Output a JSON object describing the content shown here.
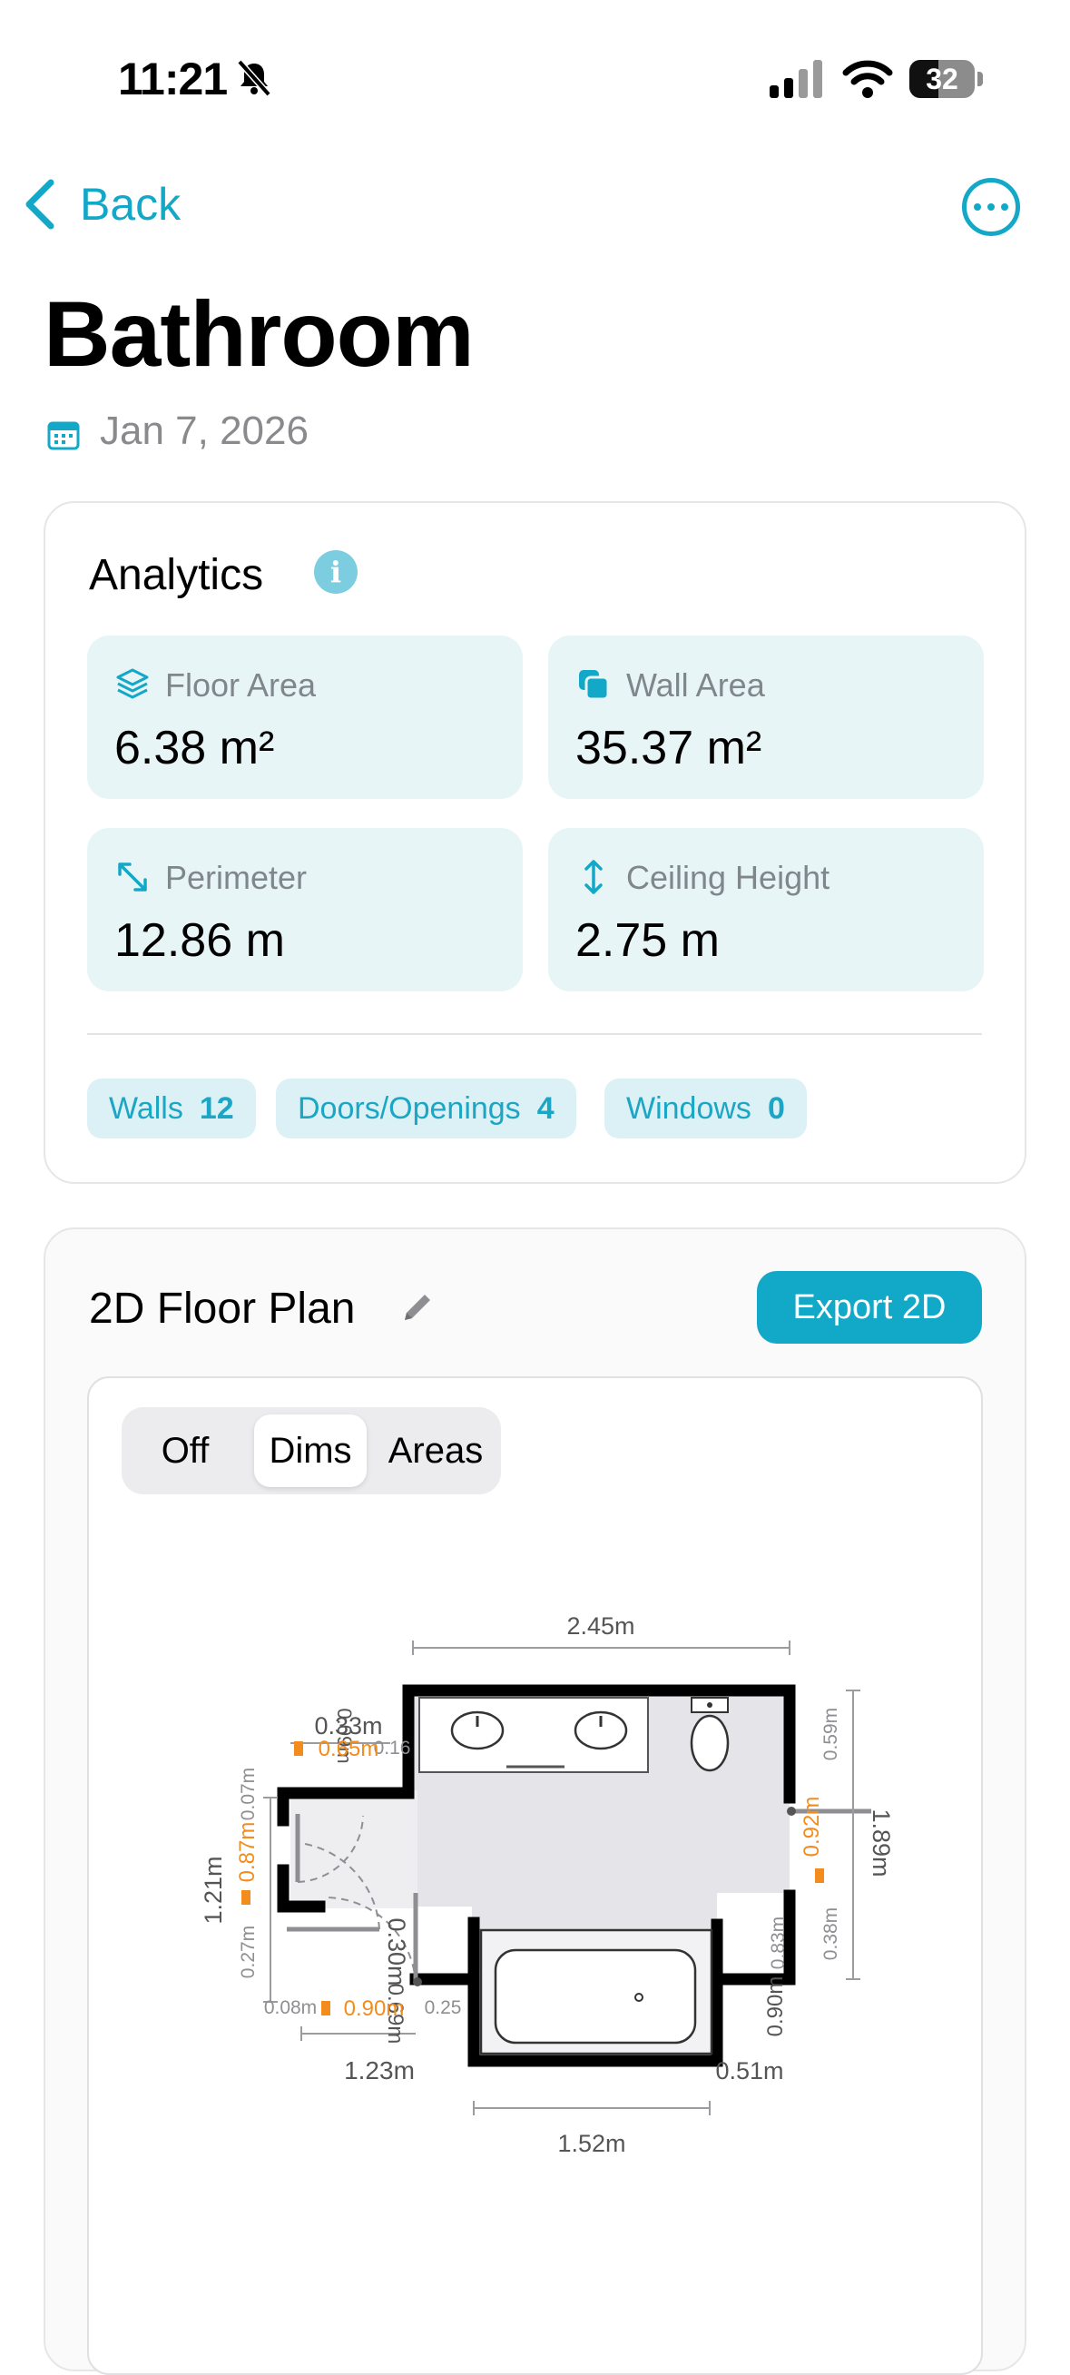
{
  "status_bar": {
    "time": "11:21",
    "battery": "32"
  },
  "nav": {
    "back_label": "Back"
  },
  "room": {
    "title": "Bathroom",
    "date": "Jan 7, 2026"
  },
  "analytics": {
    "title": "Analytics",
    "info_icon": "i",
    "stats": [
      {
        "label": "Floor Area",
        "value": "6.38 m²",
        "icon": "layers-icon"
      },
      {
        "label": "Wall Area",
        "value": "35.37 m²",
        "icon": "squares-icon"
      },
      {
        "label": "Perimeter",
        "value": "12.86 m",
        "icon": "expand-arrows-icon"
      },
      {
        "label": "Ceiling Height",
        "value": "2.75 m",
        "icon": "vertical-arrows-icon"
      }
    ],
    "counts": [
      {
        "label": "Walls",
        "value": "12"
      },
      {
        "label": "Doors/Openings",
        "value": "4"
      },
      {
        "label": "Windows",
        "value": "0"
      }
    ]
  },
  "floor_plan": {
    "title": "2D Floor Plan",
    "export_label": "Export 2D",
    "modes": [
      "Off",
      "Dims",
      "Areas"
    ],
    "selected_mode": "Dims",
    "dimensions": {
      "top": "2.45m",
      "top_left_wall": "0.33m",
      "top_left_vertical": "0.09m",
      "door_top": "0.65m",
      "door_top_small": "0.16",
      "left_total": "1.21m",
      "left_upper": "0.07m",
      "left_door": "0.87m",
      "left_lower": "0.27m",
      "right_total": "1.89m",
      "right_upper": "0.59m",
      "right_door": "0.92m",
      "right_lower": "0.38m",
      "center_vertical": "0.30m",
      "center_vertical_lower": "0.69m",
      "bottom_left_small": "0.08m",
      "bottom_door": "0.90m",
      "bottom_gap": "0.25",
      "bottom_left": "1.23m",
      "bottom_right_vertical": "0.90m",
      "bottom_right_vertical2": "0.83m",
      "bottom_right": "0.51m",
      "bathtub_width": "1.52m"
    }
  }
}
